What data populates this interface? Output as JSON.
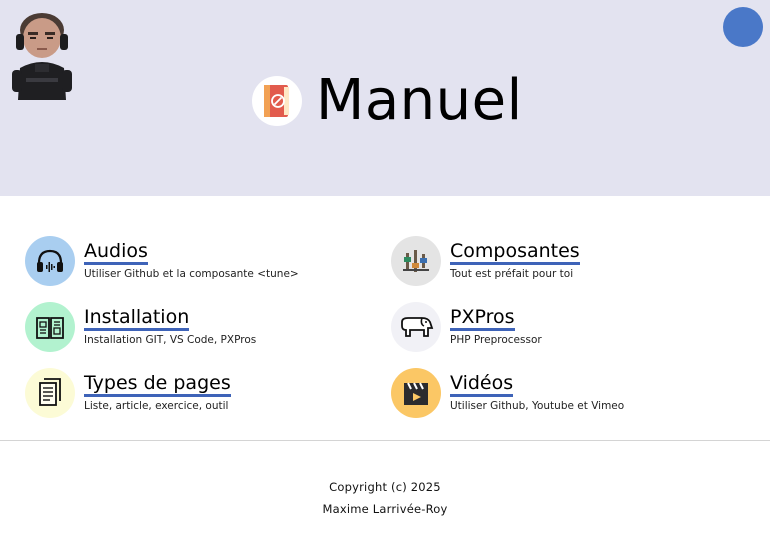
{
  "header": {
    "title": "Manuel",
    "background": "#e3e3f0",
    "user_circle_color": "#4a78c8"
  },
  "cards": [
    {
      "title": "Audios",
      "description": "Utiliser Github et la composante <tune>",
      "icon": "headphones-icon",
      "color": "#a9cef0"
    },
    {
      "title": "Composantes",
      "description": "Tout est préfait pour toi",
      "icon": "circuit-icon",
      "color": "#e4e4e4"
    },
    {
      "title": "Installation",
      "description": "Installation GIT, VS Code, PXPros",
      "icon": "manual-book-icon",
      "color": "#b2f2cf"
    },
    {
      "title": "PXPros",
      "description": "PHP Preprocessor",
      "icon": "elephant-icon",
      "color": "#f1f1f6"
    },
    {
      "title": "Types de pages",
      "description": "Liste, article, exercice, outil",
      "icon": "documents-icon",
      "color": "#fcfbd6"
    },
    {
      "title": "Vidéos",
      "description": "Utiliser Github, Youtube et Vimeo",
      "icon": "clapperboard-icon",
      "color": "#fbc765"
    }
  ],
  "footer": {
    "copyright": "Copyright (c) 2025",
    "author": "Maxime Larrivée-Roy"
  }
}
